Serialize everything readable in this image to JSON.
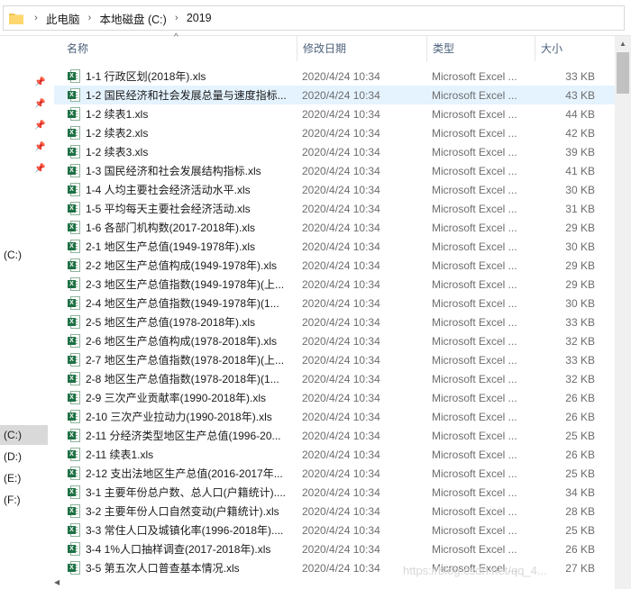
{
  "address": {
    "crumbs": [
      "此电脑",
      "本地磁盘 (C:)",
      "2019"
    ],
    "separator": "›"
  },
  "columns": {
    "name": "名称",
    "date": "修改日期",
    "type": "类型",
    "size": "大小"
  },
  "nav": {
    "drive_c_top": "(C:)",
    "drives": [
      "(C:)",
      "(D:)",
      "(E:)",
      "(F:)"
    ]
  },
  "files": [
    {
      "name": "1-1 行政区划(2018年).xls",
      "date": "2020/4/24 10:34",
      "type": "Microsoft Excel ...",
      "size": "33 KB"
    },
    {
      "name": "1-2 国民经济和社会发展总量与速度指标...",
      "date": "2020/4/24 10:34",
      "type": "Microsoft Excel ...",
      "size": "43 KB"
    },
    {
      "name": "1-2 续表1.xls",
      "date": "2020/4/24 10:34",
      "type": "Microsoft Excel ...",
      "size": "44 KB"
    },
    {
      "name": "1-2 续表2.xls",
      "date": "2020/4/24 10:34",
      "type": "Microsoft Excel ...",
      "size": "42 KB"
    },
    {
      "name": "1-2 续表3.xls",
      "date": "2020/4/24 10:34",
      "type": "Microsoft Excel ...",
      "size": "39 KB"
    },
    {
      "name": "1-3 国民经济和社会发展结构指标.xls",
      "date": "2020/4/24 10:34",
      "type": "Microsoft Excel ...",
      "size": "41 KB"
    },
    {
      "name": "1-4 人均主要社会经济活动水平.xls",
      "date": "2020/4/24 10:34",
      "type": "Microsoft Excel ...",
      "size": "30 KB"
    },
    {
      "name": "1-5 平均每天主要社会经济活动.xls",
      "date": "2020/4/24 10:34",
      "type": "Microsoft Excel ...",
      "size": "31 KB"
    },
    {
      "name": "1-6 各部门机构数(2017-2018年).xls",
      "date": "2020/4/24 10:34",
      "type": "Microsoft Excel ...",
      "size": "29 KB"
    },
    {
      "name": "2-1 地区生产总值(1949-1978年).xls",
      "date": "2020/4/24 10:34",
      "type": "Microsoft Excel ...",
      "size": "30 KB"
    },
    {
      "name": "2-2 地区生产总值构成(1949-1978年).xls",
      "date": "2020/4/24 10:34",
      "type": "Microsoft Excel ...",
      "size": "29 KB"
    },
    {
      "name": "2-3 地区生产总值指数(1949-1978年)(上...",
      "date": "2020/4/24 10:34",
      "type": "Microsoft Excel ...",
      "size": "29 KB"
    },
    {
      "name": "2-4 地区生产总值指数(1949-1978年)(1...",
      "date": "2020/4/24 10:34",
      "type": "Microsoft Excel ...",
      "size": "30 KB"
    },
    {
      "name": "2-5 地区生产总值(1978-2018年).xls",
      "date": "2020/4/24 10:34",
      "type": "Microsoft Excel ...",
      "size": "33 KB"
    },
    {
      "name": "2-6 地区生产总值构成(1978-2018年).xls",
      "date": "2020/4/24 10:34",
      "type": "Microsoft Excel ...",
      "size": "32 KB"
    },
    {
      "name": "2-7 地区生产总值指数(1978-2018年)(上...",
      "date": "2020/4/24 10:34",
      "type": "Microsoft Excel ...",
      "size": "33 KB"
    },
    {
      "name": "2-8 地区生产总值指数(1978-2018年)(1...",
      "date": "2020/4/24 10:34",
      "type": "Microsoft Excel ...",
      "size": "32 KB"
    },
    {
      "name": "2-9 三次产业贡献率(1990-2018年).xls",
      "date": "2020/4/24 10:34",
      "type": "Microsoft Excel ...",
      "size": "26 KB"
    },
    {
      "name": "2-10 三次产业拉动力(1990-2018年).xls",
      "date": "2020/4/24 10:34",
      "type": "Microsoft Excel ...",
      "size": "26 KB"
    },
    {
      "name": "2-11 分经济类型地区生产总值(1996-20...",
      "date": "2020/4/24 10:34",
      "type": "Microsoft Excel ...",
      "size": "25 KB"
    },
    {
      "name": "2-11 续表1.xls",
      "date": "2020/4/24 10:34",
      "type": "Microsoft Excel ...",
      "size": "26 KB"
    },
    {
      "name": "2-12 支出法地区生产总值(2016-2017年...",
      "date": "2020/4/24 10:34",
      "type": "Microsoft Excel ...",
      "size": "25 KB"
    },
    {
      "name": "3-1 主要年份总户数、总人口(户籍统计)....",
      "date": "2020/4/24 10:34",
      "type": "Microsoft Excel ...",
      "size": "34 KB"
    },
    {
      "name": "3-2 主要年份人口自然变动(户籍统计).xls",
      "date": "2020/4/24 10:34",
      "type": "Microsoft Excel ...",
      "size": "28 KB"
    },
    {
      "name": "3-3 常住人口及城镇化率(1996-2018年)....",
      "date": "2020/4/24 10:34",
      "type": "Microsoft Excel ...",
      "size": "25 KB"
    },
    {
      "name": "3-4 1%人口抽样调查(2017-2018年).xls",
      "date": "2020/4/24 10:34",
      "type": "Microsoft Excel ...",
      "size": "26 KB"
    },
    {
      "name": "3-5 第五次人口普查基本情况.xls",
      "date": "2020/4/24 10:34",
      "type": "Microsoft Excel ...",
      "size": "27 KB"
    }
  ],
  "selected_row": 1,
  "watermark": "https://blog.csdn.net/qq_4..."
}
